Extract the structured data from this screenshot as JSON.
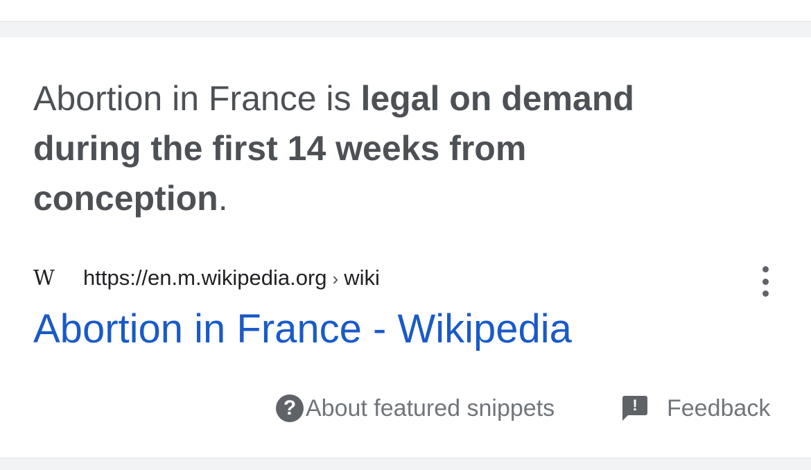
{
  "snippet": {
    "text_normal_1": "Abortion in France is ",
    "text_bold": "legal on demand during the first 14 weeks from conception",
    "text_normal_2": "."
  },
  "source": {
    "favicon_glyph": "W",
    "url_domain": "https://en.m.wikipedia.org",
    "url_separator": "›",
    "url_path": "wiki"
  },
  "result": {
    "title": "Abortion in France - Wikipedia",
    "link_color": "#1a5ac8"
  },
  "footer": {
    "about_icon_glyph": "?",
    "about_label": "About featured snippets",
    "feedback_icon_glyph": "!",
    "feedback_label": "Feedback"
  },
  "colors": {
    "snippet_text": "#4d5156",
    "secondary_text": "#70757a",
    "icon_gray": "#5f6368",
    "divider_bg": "#f1f3f4"
  },
  "icons": {
    "favicon": "wikipedia-icon",
    "menu": "more-vert-icon",
    "about": "help-circle-icon",
    "feedback": "feedback-icon"
  }
}
